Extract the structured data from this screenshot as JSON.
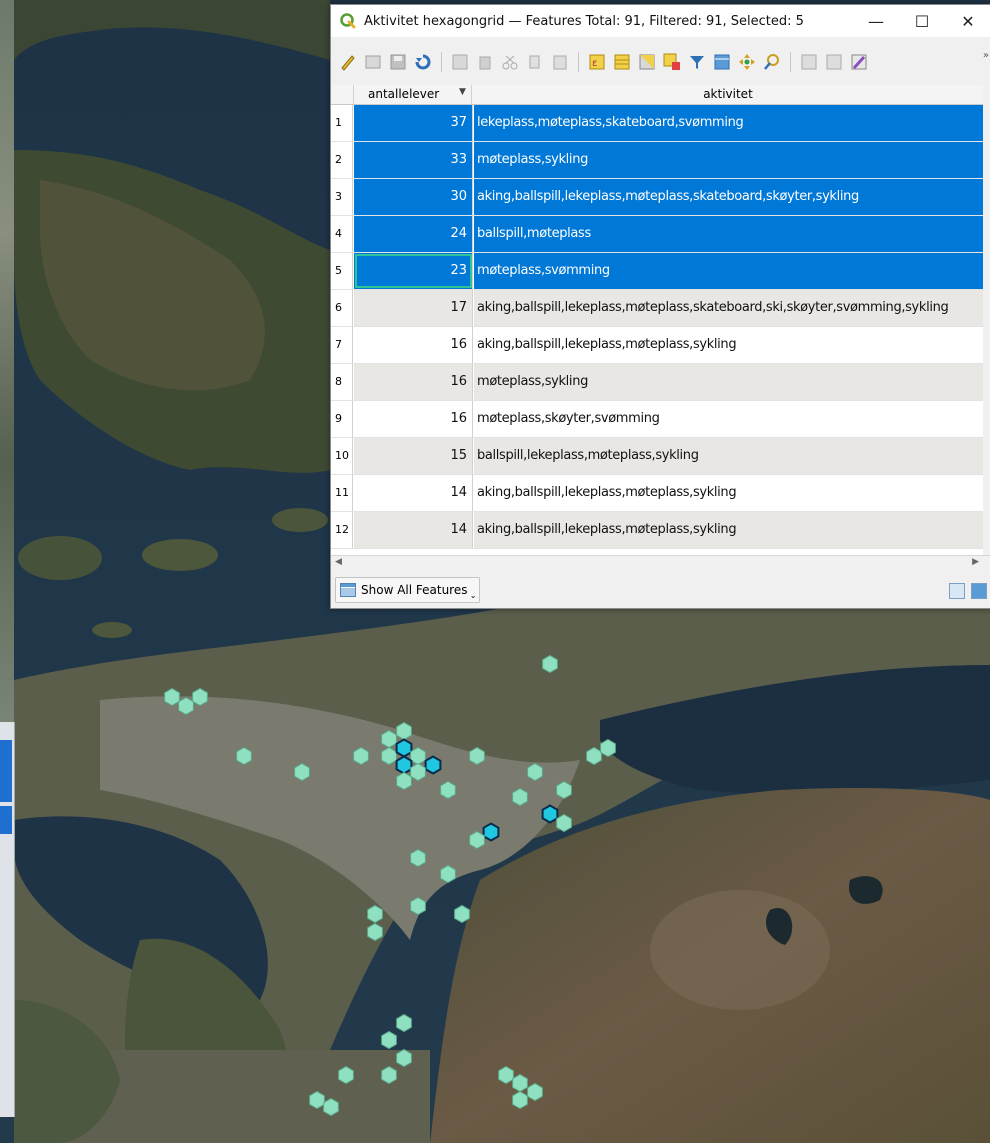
{
  "window": {
    "title": "Aktivitet hexagongrid — Features Total: 91, Filtered: 91, Selected: 5",
    "minimize": "—",
    "maximize": "☐",
    "close": "✕"
  },
  "table": {
    "columns": [
      "antallelever",
      "aktivitet"
    ],
    "rows": [
      {
        "n": "1",
        "antallelever": "37",
        "aktivitet": "lekeplass,møteplass,skateboard,svømming",
        "state": "sel"
      },
      {
        "n": "2",
        "antallelever": "33",
        "aktivitet": "møteplass,sykling",
        "state": "sel"
      },
      {
        "n": "3",
        "antallelever": "30",
        "aktivitet": "aking,ballspill,lekeplass,møteplass,skateboard,skøyter,sykling",
        "state": "sel"
      },
      {
        "n": "4",
        "antallelever": "24",
        "aktivitet": "ballspill,møteplass",
        "state": "sel"
      },
      {
        "n": "5",
        "antallelever": "23",
        "aktivitet": "møteplass,svømming",
        "state": "sel cur"
      },
      {
        "n": "6",
        "antallelever": "17",
        "aktivitet": "aking,ballspill,lekeplass,møteplass,skateboard,ski,skøyter,svømming,sykling",
        "state": "alt"
      },
      {
        "n": "7",
        "antallelever": "16",
        "aktivitet": "aking,ballspill,lekeplass,møteplass,sykling",
        "state": "norm"
      },
      {
        "n": "8",
        "antallelever": "16",
        "aktivitet": "møteplass,sykling",
        "state": "alt"
      },
      {
        "n": "9",
        "antallelever": "16",
        "aktivitet": "møteplass,skøyter,svømming",
        "state": "norm"
      },
      {
        "n": "10",
        "antallelever": "15",
        "aktivitet": "ballspill,lekeplass,møteplass,sykling",
        "state": "alt"
      },
      {
        "n": "11",
        "antallelever": "14",
        "aktivitet": "aking,ballspill,lekeplass,møteplass,sykling",
        "state": "norm"
      },
      {
        "n": "12",
        "antallelever": "14",
        "aktivitet": "aking,ballspill,lekeplass,møteplass,sykling",
        "state": "alt"
      }
    ]
  },
  "bottom": {
    "show_label": "Show All Features"
  },
  "colors": {
    "selection": "#0078d7",
    "hex_fill": "#8fe0c0",
    "hex_selected": "#1fc8e0"
  }
}
